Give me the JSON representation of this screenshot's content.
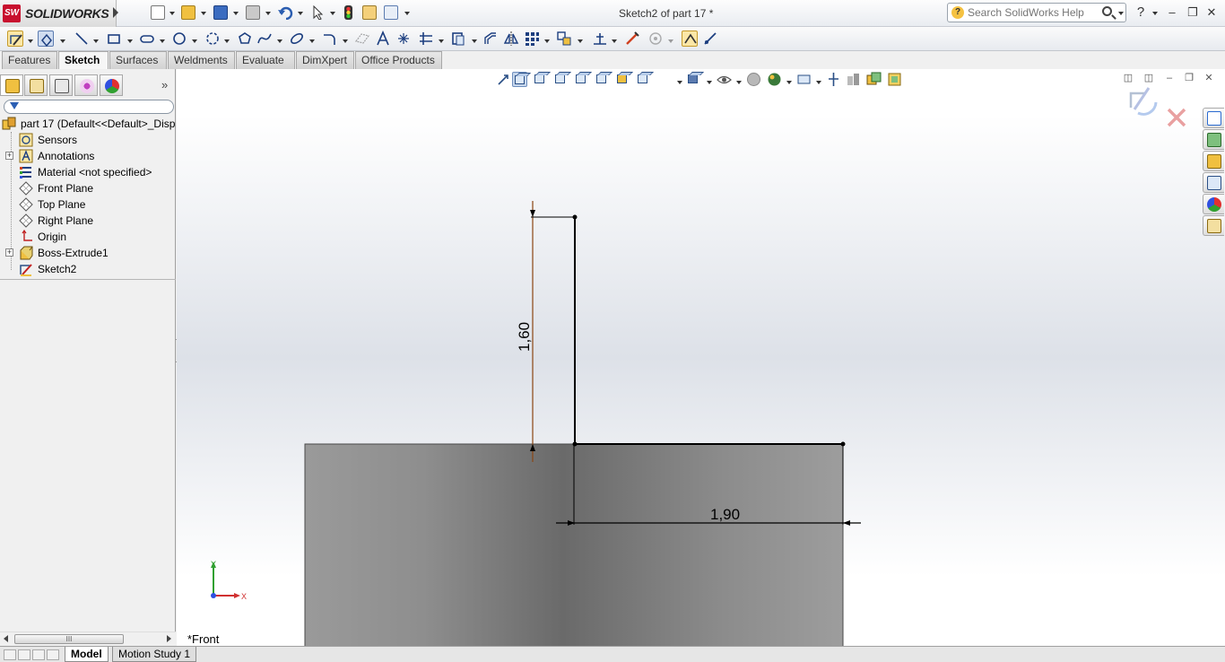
{
  "app": {
    "name": "SOLIDWORKS",
    "logo_text": "SW",
    "document_title": "Sketch2 of part 17 *"
  },
  "search": {
    "placeholder": "Search SolidWorks Help",
    "help_glyph": "?"
  },
  "window_controls": {
    "help": "?",
    "minimize": "‒",
    "restore": "❐",
    "close": "✕"
  },
  "command_tabs": [
    "Features",
    "Sketch",
    "Surfaces",
    "Weldments",
    "Evaluate",
    "DimXpert",
    "Office Products"
  ],
  "active_command_tab": "Sketch",
  "panel_tabs": [
    "feature-manager-icon",
    "property-manager-icon",
    "configuration-manager-icon",
    "dimxpert-manager-icon",
    "display-manager-icon"
  ],
  "panel_expand": "»",
  "feature_tree": {
    "root": "part 17  (Default<<Default>_Disp",
    "items": [
      {
        "label": "Sensors",
        "icon": "sensor-icon",
        "expandable": false
      },
      {
        "label": "Annotations",
        "icon": "annotations-icon",
        "expandable": true
      },
      {
        "label": "Material <not specified>",
        "icon": "material-icon",
        "expandable": false
      },
      {
        "label": "Front Plane",
        "icon": "plane-icon",
        "expandable": false
      },
      {
        "label": "Top Plane",
        "icon": "plane-icon",
        "expandable": false
      },
      {
        "label": "Right Plane",
        "icon": "plane-icon",
        "expandable": false
      },
      {
        "label": "Origin",
        "icon": "origin-icon",
        "expandable": false
      },
      {
        "label": "Boss-Extrude1",
        "icon": "extrude-icon",
        "expandable": true
      },
      {
        "label": "Sketch2",
        "icon": "sketch-icon",
        "expandable": false
      }
    ]
  },
  "scrollbar": {
    "thumb_grip": "III"
  },
  "viewport": {
    "view_name": "*Front",
    "dimensions": {
      "vertical": "1,60",
      "horizontal": "1,90"
    },
    "triad": {
      "y": "Y",
      "x": "X"
    }
  },
  "task_pane": [
    "home-icon",
    "design-library-icon",
    "file-explorer-icon",
    "view-palette-icon",
    "appearances-icon",
    "custom-properties-icon"
  ],
  "colors": {
    "accent": "#2b5fb3",
    "brand": "#c8102e",
    "part": "#808080",
    "sketch_line": "#000000",
    "dimension_line": "#8b4513"
  },
  "bottom_tabs": [
    "Model",
    "Motion Study 1"
  ],
  "active_bottom_tab": "Model"
}
